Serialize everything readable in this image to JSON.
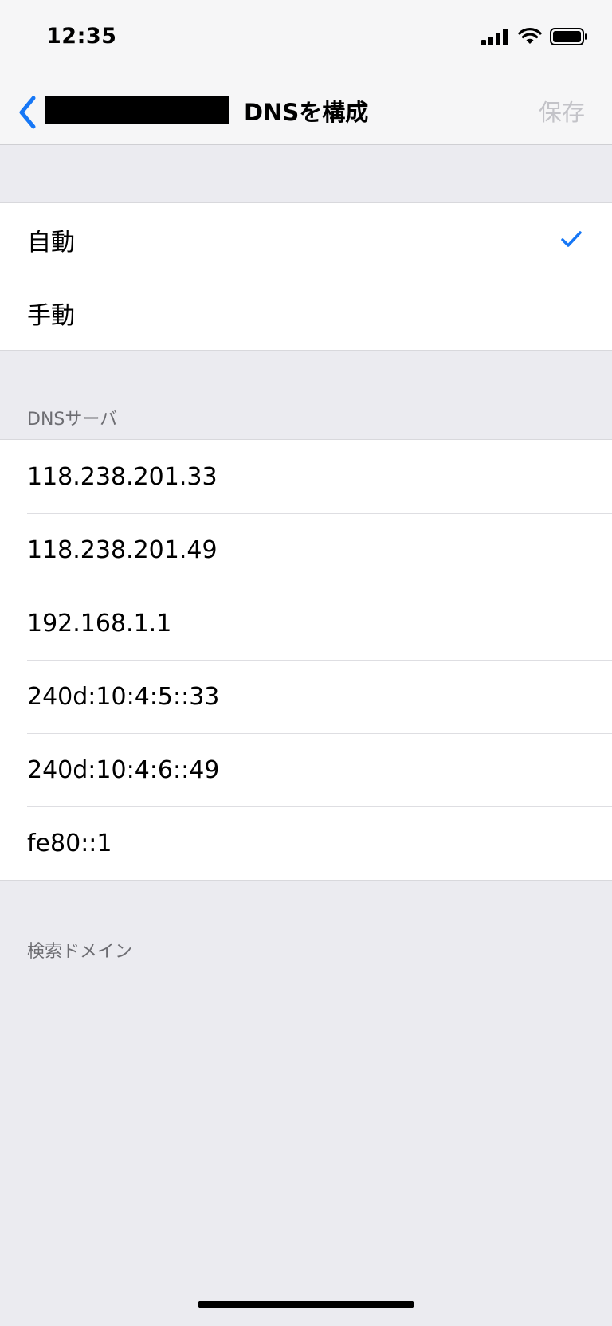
{
  "status_bar": {
    "time": "12:35"
  },
  "nav": {
    "back_icon": "chevron-left-icon",
    "title": "DNSを構成",
    "save_label": "保存",
    "accent_color": "#1677f6"
  },
  "mode_options": [
    {
      "label": "自動",
      "selected": true
    },
    {
      "label": "手動",
      "selected": false
    }
  ],
  "dns_section": {
    "header": "DNSサーバ",
    "servers": [
      "118.238.201.33",
      "118.238.201.49",
      "192.168.1.1",
      "240d:10:4:5::33",
      "240d:10:4:6::49",
      "fe80::1"
    ]
  },
  "search_section": {
    "header": "検索ドメイン"
  }
}
